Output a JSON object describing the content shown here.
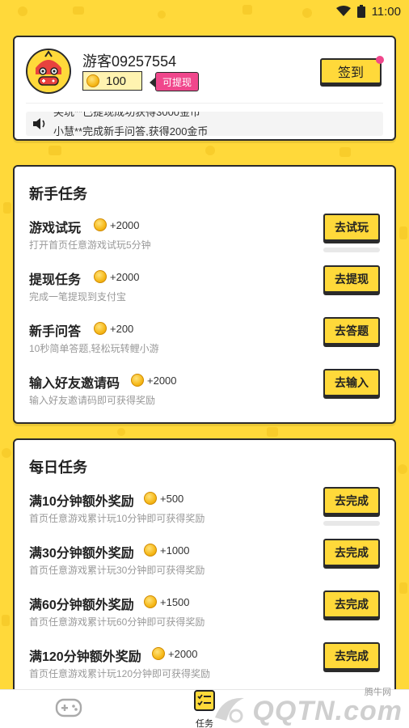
{
  "status_bar": {
    "time": "11:00",
    "wifi_icon": "wifi-icon",
    "battery_icon": "battery-icon"
  },
  "profile": {
    "username": "游客09257554",
    "coins": "100",
    "withdraw_tag": "可提现",
    "signin_label": "签到",
    "marquee": [
      "笑玩**已提现成功获得3000金币",
      "小慧**完成新手问答,获得200金币"
    ]
  },
  "newbie_section": {
    "title": "新手任务",
    "tasks": [
      {
        "name": "游戏试玩",
        "reward": "+2000",
        "desc": "打开首页任意游戏试玩5分钟",
        "button": "去试玩"
      },
      {
        "name": "提现任务",
        "reward": "+2000",
        "desc": "完成一笔提现到支付宝",
        "button": "去提现"
      },
      {
        "name": "新手问答",
        "reward": "+200",
        "desc": "10秒简单答题,轻松玩转鲤小游",
        "button": "去答题"
      },
      {
        "name": "输入好友邀请码",
        "reward": "+2000",
        "desc": "输入好友邀请码即可获得奖励",
        "button": "去输入"
      }
    ]
  },
  "daily_section": {
    "title": "每日任务",
    "tasks": [
      {
        "name": "满10分钟额外奖励",
        "reward": "+500",
        "desc": "首页任意游戏累计玩10分钟即可获得奖励",
        "button": "去完成"
      },
      {
        "name": "满30分钟额外奖励",
        "reward": "+1000",
        "desc": "首页任意游戏累计玩30分钟即可获得奖励",
        "button": "去完成"
      },
      {
        "name": "满60分钟额外奖励",
        "reward": "+1500",
        "desc": "首页任意游戏累计玩60分钟即可获得奖励",
        "button": "去完成"
      },
      {
        "name": "满120分钟额外奖励",
        "reward": "+2000",
        "desc": "首页任意游戏累计玩120分钟即可获得奖励",
        "button": "去完成"
      }
    ]
  },
  "bottom_nav": {
    "items": [
      {
        "icon": "gamepad-icon",
        "label": ""
      },
      {
        "icon": "task-list-icon",
        "label": "任务"
      }
    ]
  },
  "watermark": {
    "small": "腾牛网",
    "large": "QQTN.com"
  },
  "colors": {
    "accent": "#FFD93A",
    "pink": "#F0478C",
    "border": "#2a2a2a"
  }
}
